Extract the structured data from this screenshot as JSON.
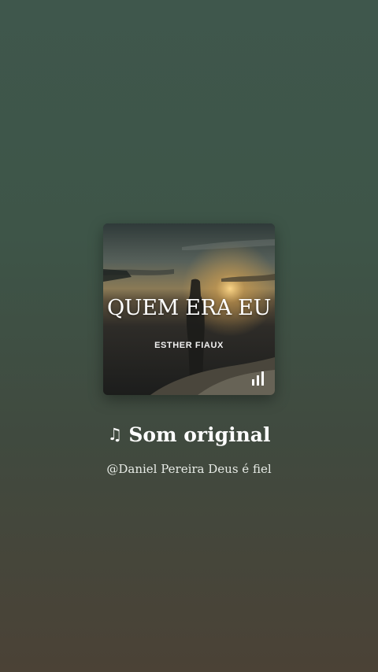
{
  "album": {
    "title": "QUEM ERA EU",
    "artist": "ESTHER FIAUX",
    "playing_icon": "audio-bars-icon"
  },
  "sound": {
    "note_icon": "♫",
    "title": "Som original",
    "author": "@Daniel Pereira Deus é fiel"
  },
  "colors": {
    "background_top": "#3f574c",
    "background_bottom": "#4b4236",
    "text_primary": "#ffffff",
    "text_secondary": "#e7ebe6"
  }
}
